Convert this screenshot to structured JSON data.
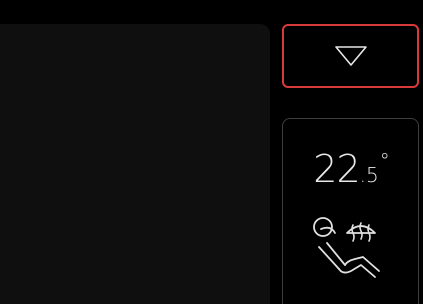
{
  "header": {
    "collapse_icon": "triangle-down-icon",
    "accent_color": "#d8393b"
  },
  "climate": {
    "temperature_whole": "22",
    "temperature_decimal": ".5",
    "temperature_unit": "°",
    "seat_icon": "seat-heating-icon",
    "defrost_icon": "rear-defrost-icon"
  }
}
